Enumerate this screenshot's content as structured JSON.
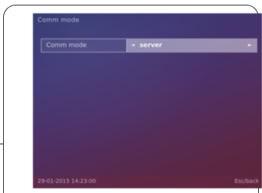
{
  "screen": {
    "title": "Comm mode"
  },
  "setting": {
    "label": "Comm mode",
    "value": "server",
    "arrow_left": "◄",
    "arrow_right": "►"
  },
  "status": {
    "datetime": "29-01-2015 14:23:00",
    "back_label": "Esc/back"
  },
  "colors": {
    "background_top": "#2c3466",
    "background_bottom": "#5c2438"
  }
}
